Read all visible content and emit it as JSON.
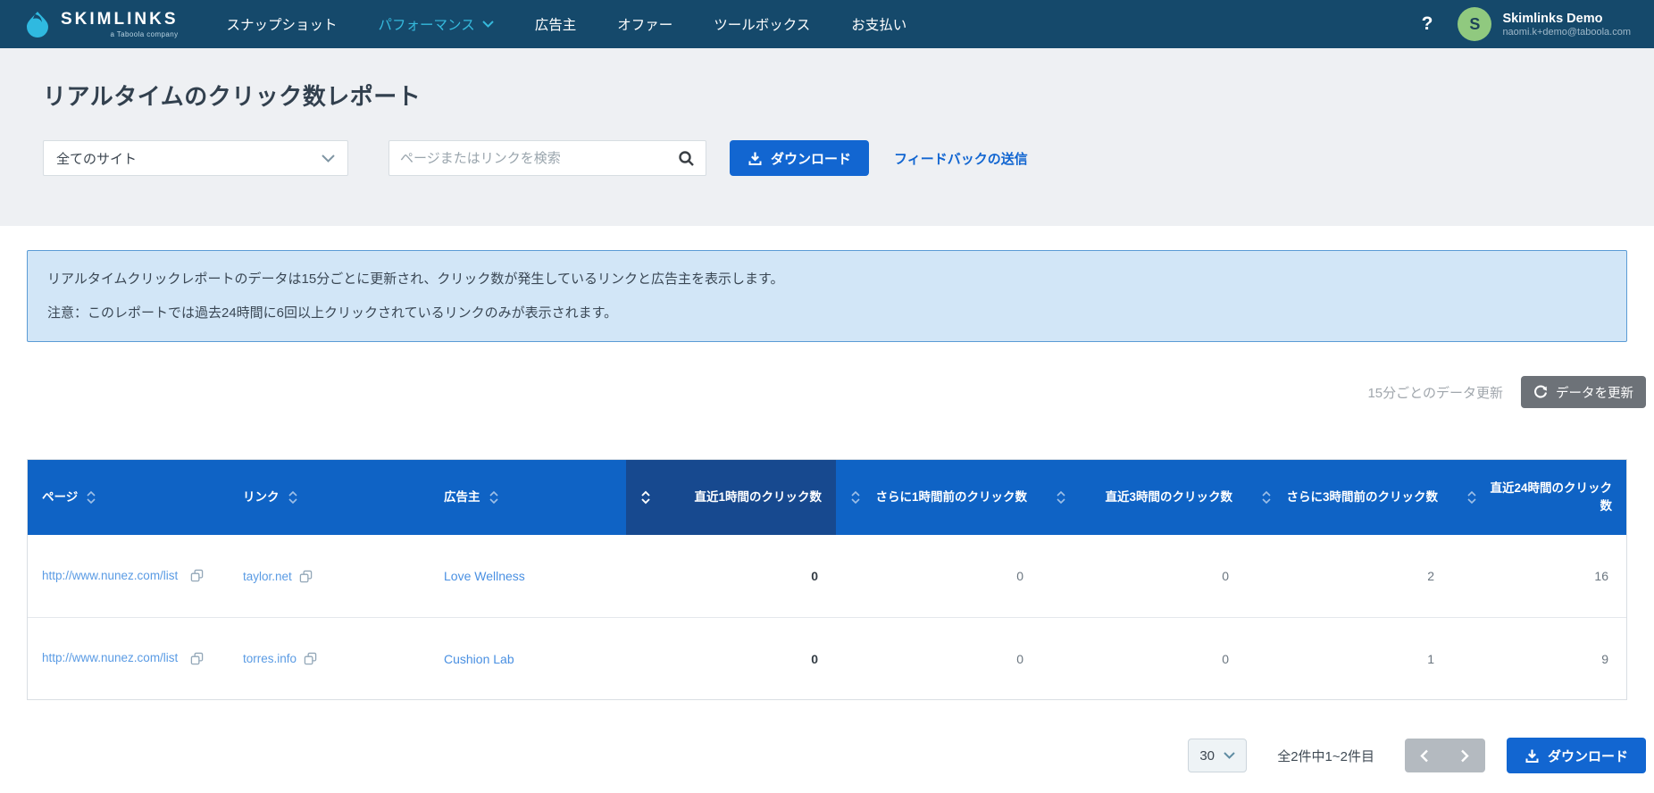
{
  "nav": {
    "brand": {
      "name": "SKIMLINKS",
      "subtitle": "a Taboola company"
    },
    "items": [
      {
        "label": "スナップショット",
        "active": false
      },
      {
        "label": "パフォーマンス",
        "active": true,
        "has_dropdown": true
      },
      {
        "label": "広告主",
        "active": false
      },
      {
        "label": "オファー",
        "active": false
      },
      {
        "label": "ツールボックス",
        "active": false
      },
      {
        "label": "お支払い",
        "active": false
      }
    ],
    "help_glyph": "?",
    "user": {
      "initial": "S",
      "name": "Skimlinks Demo",
      "email": "naomi.k+demo@taboola.com"
    }
  },
  "header": {
    "title": "リアルタイムのクリック数レポート",
    "site_filter_value": "全てのサイト",
    "search_placeholder": "ページまたはリンクを検索",
    "download_label": "ダウンロード",
    "feedback_label": "フィードバックの送信"
  },
  "banner": {
    "line1": "リアルタイムクリックレポートのデータは15分ごとに更新され、クリック数が発生しているリンクと広告主を表示します。",
    "line2": "注意：このレポートでは過去24時間に6回以上クリックされているリンクのみが表示されます。"
  },
  "refresh": {
    "note": "15分ごとのデータ更新",
    "button_label": "データを更新"
  },
  "table": {
    "columns": [
      "ページ",
      "リンク",
      "広告主",
      "直近1時間のクリック数",
      "さらに1時間前のクリック数",
      "直近3時間のクリック数",
      "さらに3時間前のクリック数",
      "直近24時間のクリック数"
    ],
    "sorted_column": "直近1時間のクリック数",
    "rows": [
      {
        "page": "http://www.nunez.com/list",
        "link": "taylor.net",
        "advertiser": "Love Wellness",
        "clicks_last_1h": "0",
        "clicks_prev_1h": "0",
        "clicks_last_3h": "0",
        "clicks_prev_3h": "2",
        "clicks_last_24h": "16"
      },
      {
        "page": "http://www.nunez.com/list",
        "link": "torres.info",
        "advertiser": "Cushion Lab",
        "clicks_last_1h": "0",
        "clicks_prev_1h": "0",
        "clicks_last_3h": "0",
        "clicks_prev_3h": "1",
        "clicks_last_24h": "9"
      }
    ]
  },
  "pagination": {
    "per_page": "30",
    "range_text": "全2件中1~2件目",
    "download_label": "ダウンロード"
  },
  "icons": {
    "logo": "skimlinks-droplet",
    "nav_dropdown": "chevron-down",
    "help": "question-mark",
    "search": "magnifier",
    "download": "arrow-down-tray",
    "refresh": "circular-arrow",
    "sort": "chevron-up-down",
    "copy": "overlapping-squares",
    "pager_prev": "chevron-left",
    "pager_next": "chevron-right"
  },
  "colors": {
    "nav_navy": "#15496b",
    "accent_cyan": "#35b9dc",
    "primary_blue": "#1266d1",
    "table_header_blue": "#0f63c5",
    "sorted_column_blue": "#17498f",
    "banner_bg": "#d2e6f7",
    "banner_border": "#5b9bd5",
    "avatar_green": "#90c97f",
    "link_blue": "#4a90e2",
    "refresh_gray": "#6d7278",
    "pager_gray": "#b4bac0"
  }
}
